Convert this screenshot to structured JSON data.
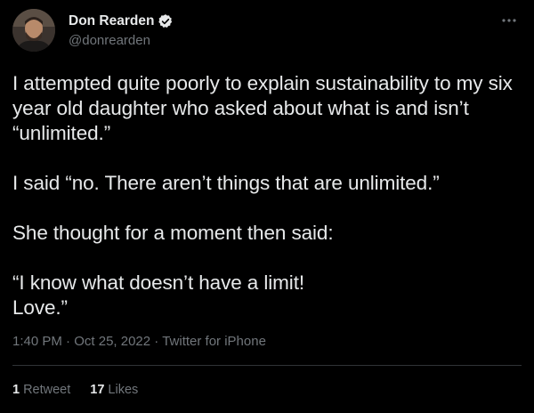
{
  "user": {
    "display_name": "Don Rearden",
    "handle": "@donrearden",
    "verified": true
  },
  "tweet": {
    "paragraphs": [
      "I attempted quite poorly to explain sustainability to my six year old daughter who asked about what is and isn’t “unlimited.”",
      "I said “no. There aren’t things that are unlimited.”",
      "She thought for a moment then said:",
      "“I know what doesn’t have a limit!\nLove.”"
    ],
    "time": "1:40 PM",
    "date": "Oct 25, 2022",
    "source": "Twitter for iPhone",
    "separator": "·"
  },
  "stats": {
    "retweets_count": "1",
    "retweets_label": "Retweet",
    "likes_count": "17",
    "likes_label": "Likes"
  },
  "colors": {
    "background": "#000000",
    "text_primary": "#e7e9ea",
    "text_secondary": "#71767b",
    "verified_blue": "#ffffff",
    "divider": "#2f3336"
  },
  "icons": {
    "verified": "verified-badge-icon",
    "more": "more-dots-icon"
  }
}
